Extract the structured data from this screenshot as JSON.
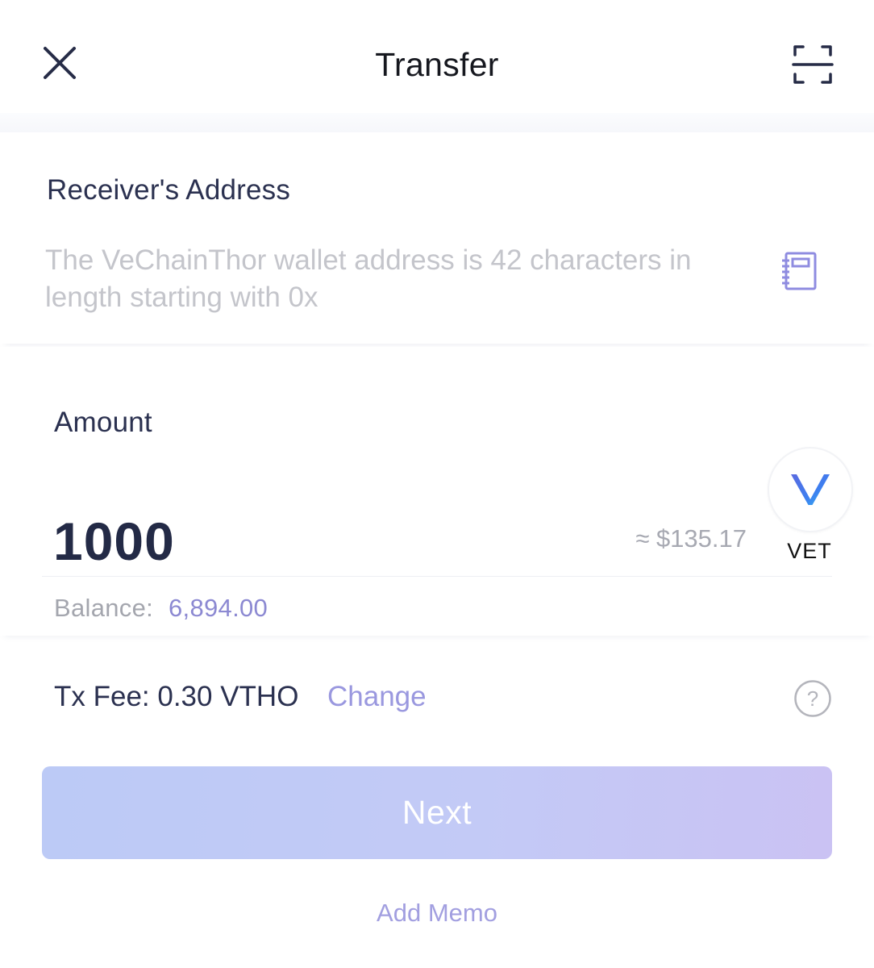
{
  "header": {
    "title": "Transfer"
  },
  "receiver": {
    "label": "Receiver's Address",
    "placeholder": "The VeChainThor wallet address is 42 characters in length starting with 0x"
  },
  "amount": {
    "label": "Amount",
    "value": "1000",
    "fiat_estimate": "≈ $135.17",
    "token_symbol": "VET",
    "balance_label": "Balance:",
    "balance_value": "6,894.00"
  },
  "fee": {
    "text": "Tx Fee: 0.30 VTHO",
    "change_label": "Change"
  },
  "actions": {
    "next_label": "Next",
    "memo_label": "Add Memo"
  },
  "colors": {
    "accent": "#9a98df",
    "button_gradient_start": "#bccaf6",
    "button_gradient_end": "#cac2f3",
    "text_primary": "#2b3150",
    "text_muted": "#a4a6ae"
  },
  "icons": {
    "close": "close-icon",
    "scan": "scan-icon",
    "address_book": "address-book-icon",
    "token_logo": "vet-logo-icon",
    "help": "help-icon"
  }
}
